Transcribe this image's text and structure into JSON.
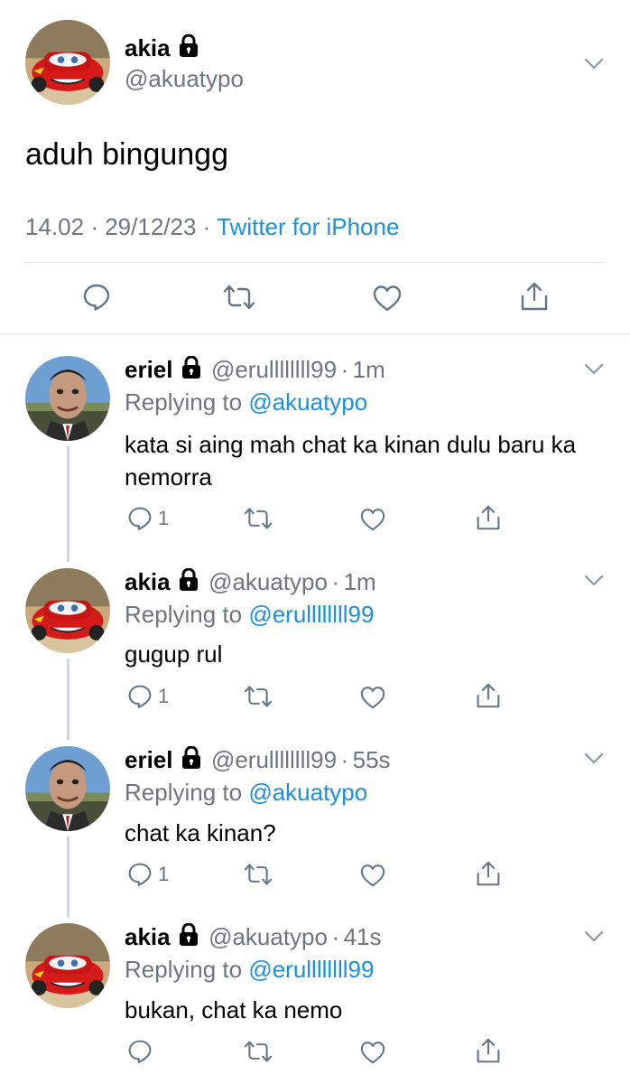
{
  "main_tweet": {
    "name": "akia",
    "handle": "@akuatypo",
    "text": "aduh bingungg",
    "time": "14.02",
    "sep1": "·",
    "date": "29/12/23",
    "sep2": "·",
    "source": "Twitter for iPhone"
  },
  "replies": [
    {
      "name": "eriel",
      "handle": "@erullllllll99",
      "sep": "·",
      "time": "1m",
      "replying_prefix": "Replying to ",
      "replying_to": "@akuatypo",
      "text": "kata si aing mah chat ka kinan dulu baru ka nemorra",
      "reply_count": "1"
    },
    {
      "name": "akia",
      "handle": "@akuatypo",
      "sep": "·",
      "time": "1m",
      "replying_prefix": "Replying to ",
      "replying_to": "@erullllllll99",
      "text": "gugup rul",
      "reply_count": "1"
    },
    {
      "name": "eriel",
      "handle": "@erullllllll99",
      "sep": "·",
      "time": "55s",
      "replying_prefix": "Replying to ",
      "replying_to": "@akuatypo",
      "text": "chat ka kinan?",
      "reply_count": "1"
    },
    {
      "name": "akia",
      "handle": "@akuatypo",
      "sep": "·",
      "time": "41s",
      "replying_prefix": "Replying to ",
      "replying_to": "@erullllllll99",
      "text": "bukan, chat ka nemo",
      "reply_count": ""
    }
  ],
  "colors": {
    "link": "#1d8fe1",
    "muted": "#6e767d",
    "divider": "#e6ecf0"
  },
  "icons": [
    "lock-icon",
    "chevron-down-icon",
    "reply-icon",
    "retweet-icon",
    "like-icon",
    "share-icon"
  ]
}
